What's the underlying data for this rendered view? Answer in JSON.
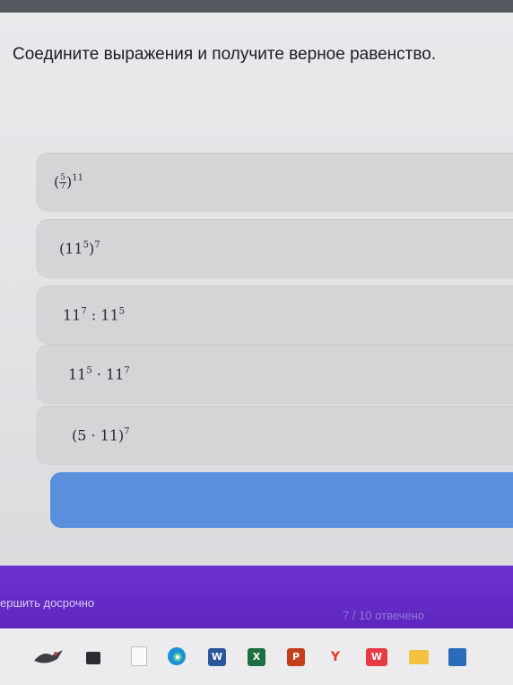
{
  "question": {
    "text": "Соедините выражения и получите верное равенство."
  },
  "expressions": [
    {
      "base_num": "5",
      "base_den": "7",
      "exp": "11"
    },
    {
      "left": "(11",
      "inner_exp": "5",
      "right": ")",
      "exp": "7"
    },
    {
      "a": "11",
      "a_exp": "7",
      "op": " : ",
      "b": "11",
      "b_exp": "5"
    },
    {
      "a": "11",
      "a_exp": "5",
      "op": " · ",
      "b": "11",
      "b_exp": "7"
    },
    {
      "text": "(5 · 11)",
      "exp": "7"
    }
  ],
  "footer": {
    "finish_label": "ершить досрочно",
    "progress_text": "7 / 10 отвечено"
  },
  "taskbar": {
    "icons": [
      "bird-icon",
      "folder-icon",
      "document-icon",
      "edge-icon",
      "word-icon",
      "excel-icon",
      "powerpoint-icon",
      "yandex-icon",
      "wps-icon",
      "file-explorer-icon",
      "store-icon"
    ],
    "labels": {
      "word": "W",
      "excel": "X",
      "powerpoint": "P",
      "yandex": "Y",
      "wps": "W"
    }
  },
  "colors": {
    "accent_button": "#5a8fdc",
    "footer": "#5f26c2",
    "card": "#d5d5d8"
  }
}
